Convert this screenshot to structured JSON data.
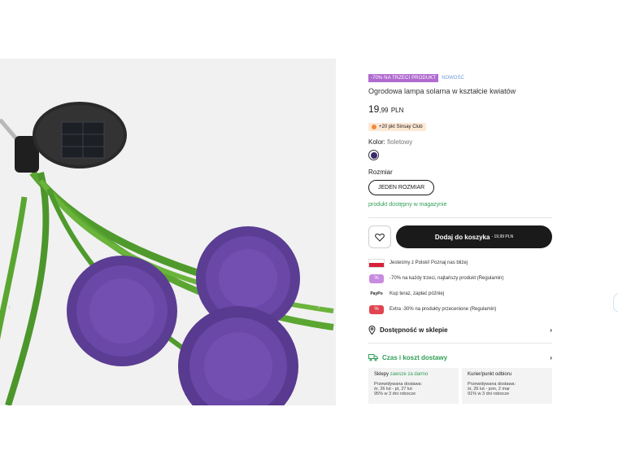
{
  "gallery": {
    "alt": "Ogrodowa lampa solarna w kształcie kwiatów",
    "prev_icon": "chevron-left-icon",
    "next_icon": "chevron-right-icon"
  },
  "badges": {
    "promo": "-70% NA TRZECI PRODUKT",
    "new": "NOWOŚĆ"
  },
  "product": {
    "title": "Ogrodowa lampa solarna w kształcie kwiatów",
    "price_main": "19",
    "price_dec": ",99",
    "price_currency": "PLN"
  },
  "club": {
    "text": "+20 pkt Sinsay Club"
  },
  "color": {
    "label": "Kolor:",
    "value": "fioletowy",
    "swatch": "#3b2a6d"
  },
  "size": {
    "label": "Rozmiar",
    "option": "JEDEN ROZMIAR"
  },
  "availability": "produkt dostępny w magazynie",
  "cart": {
    "add_label": "Dodaj do koszyka",
    "add_price": "- 19,99 PLN",
    "wishlist_icon": "heart-icon"
  },
  "features": [
    {
      "icon": "poland-flag-icon",
      "text": "Jesteśmy z Polski! Poznaj nas bliżej"
    },
    {
      "icon": "percent-tag-icon",
      "text": "-70% na każdy trzeci, najtańszy produkt (Regulamin)"
    },
    {
      "icon": "paypo-icon",
      "label": "PayPo",
      "text": "Kup teraz, zapłać później"
    },
    {
      "icon": "discount-tag-icon",
      "text": "Extra -30% na produkty przecenione (Regulamin)"
    }
  ],
  "store_availability": {
    "label": "Dostępność w sklepie",
    "icon": "location-pin-icon"
  },
  "delivery": {
    "label": "Czas i koszt dostawy",
    "icon": "truck-icon",
    "cards": [
      {
        "title": "Sklepy",
        "note": "zawsze za darmo",
        "line1": "Przewidywana dostawa:",
        "line2": "śr, 26 lut - pt, 27 lut",
        "line3": "95% w 3 dni robocze"
      },
      {
        "title": "Kurier/punkt odbioru",
        "note": "",
        "line1": "Przewidywana dostawa:",
        "line2": "śr, 26 lut - pon, 2 mar",
        "line3": "91% w 3 dni robocze"
      }
    ]
  },
  "colors": {
    "accent_promo": "#b16bd0",
    "available_green": "#2f9e55",
    "cart_button": "#1a1a1a"
  }
}
